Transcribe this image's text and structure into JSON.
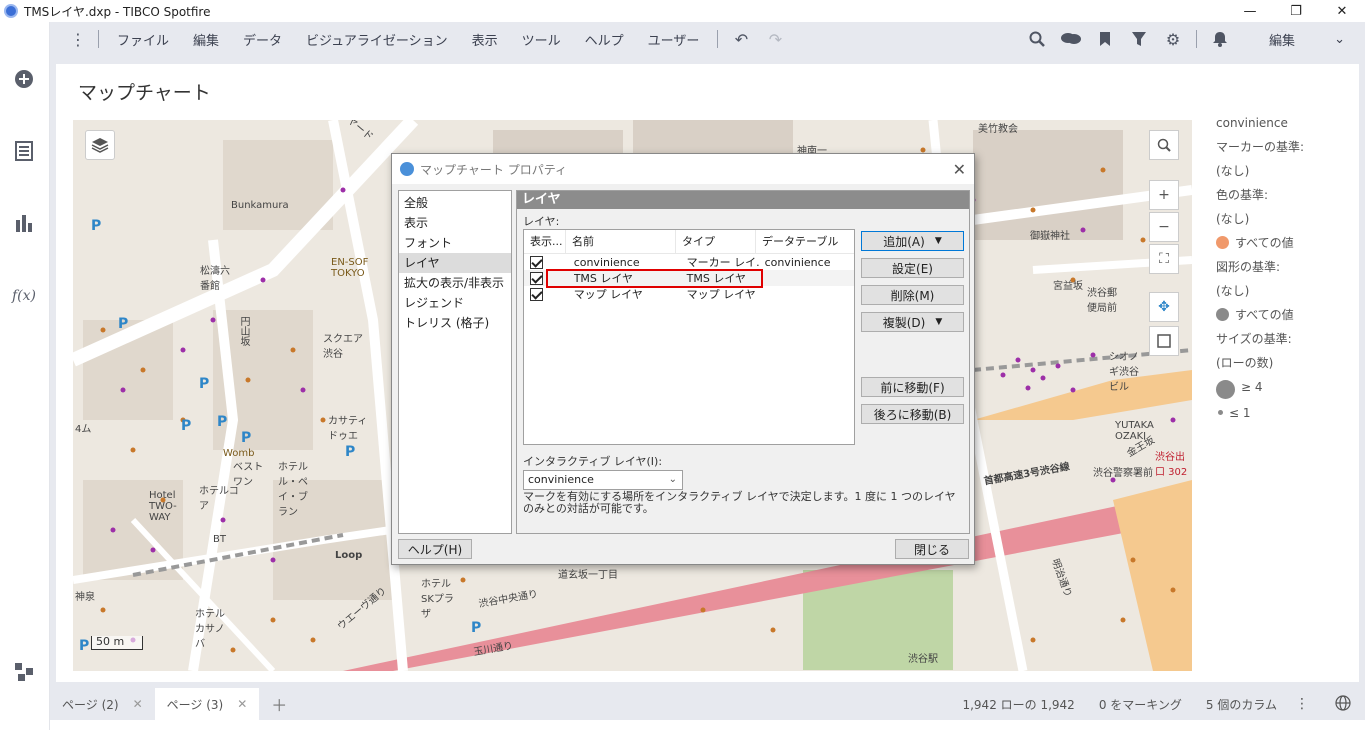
{
  "window": {
    "title": "TMSレイヤ.dxp - TIBCO Spotfire",
    "controls": [
      "—",
      "❐",
      "✕"
    ]
  },
  "rail": {
    "icons": [
      "add-icon",
      "data-table-icon",
      "bar-chart-icon",
      "function-icon",
      "flow-icon"
    ],
    "fx_label": "f(x)"
  },
  "menu": {
    "items": [
      "ファイル",
      "編集",
      "データ",
      "ビジュアライゼーション",
      "表示",
      "ツール",
      "ヘルプ",
      "ユーザー"
    ],
    "mode": "編集"
  },
  "viz": {
    "title": "マップチャート"
  },
  "map": {
    "scale": "50 m",
    "labels": [
      "Bunkamura",
      "松濤六番館",
      "EN-SOF TOKYO",
      "円山坂",
      "スクエア渋谷",
      "カサティドゥエ",
      "Womb",
      "ベストワン",
      "ホテルル・ペイ・ブラン",
      "ホテルコア",
      "Hotel TWO-WAY",
      "BT",
      "Loop",
      "ホテルSKプラザ",
      "ホテルカサノバ",
      "渋谷中央通り",
      "ウエーヴ通り",
      "玉川通り",
      "首都高速3号渋谷線",
      "道玄坂一丁目",
      "美竹教会",
      "御嶽神社",
      "宮益坂",
      "渋谷郵便局前",
      "シオノギ渋谷ビル",
      "YUTAKA OZAKI",
      "金王坂",
      "渋谷警察署前",
      "明治通り",
      "渋谷駅",
      "渋谷出口 302",
      "神南一",
      "神泉",
      "4ム",
      "ヤード"
    ]
  },
  "legend": {
    "title": "convinience",
    "marker_basis_label": "マーカーの基準:",
    "marker_basis_value": "(なし)",
    "color_basis_label": "色の基準:",
    "color_basis_value": "(なし)",
    "color_all": "すべての値",
    "shape_basis_label": "図形の基準:",
    "shape_basis_value": "(なし)",
    "shape_all": "すべての値",
    "size_basis_label": "サイズの基準:",
    "size_basis_value": "(ローの数)",
    "size_large": "≥ 4",
    "size_small": "≤ 1",
    "color_swatch": "#f0996b",
    "shape_swatch": "#8a8a8a"
  },
  "dialog": {
    "title": "マップチャート プロパティ",
    "nav": [
      "全般",
      "表示",
      "フォント",
      "レイヤ",
      "拡大の表示/非表示",
      "レジェンド",
      "トレリス (格子)"
    ],
    "selected_nav": "レイヤ",
    "header": "レイヤ",
    "layers_label": "レイヤ:",
    "columns": [
      "表示...",
      "名前",
      "タイプ",
      "データテーブル"
    ],
    "rows": [
      {
        "name": "convinience",
        "type": "マーカー レイ...",
        "table": "convinience"
      },
      {
        "name": "TMS レイヤ",
        "type": "TMS レイヤ",
        "table": ""
      },
      {
        "name": "マップ レイヤ",
        "type": "マップ レイヤ",
        "table": ""
      }
    ],
    "buttons": {
      "add": "追加(A)",
      "settings": "設定(E)",
      "delete": "削除(M)",
      "duplicate": "複製(D)",
      "move_up": "前に移動(F)",
      "move_down": "後ろに移動(B)",
      "help": "ヘルプ(H)",
      "close": "閉じる"
    },
    "interactive_label": "インタラクティブ レイヤ(I):",
    "interactive_value": "convinience",
    "description": "マークを有効にする場所をインタラクティブ レイヤで決定します。1 度に 1 つのレイヤのみとの対話が可能です。"
  },
  "status": {
    "tabs": [
      {
        "label": "ページ (2)"
      },
      {
        "label": "ページ (3)"
      }
    ],
    "add_tab": "＋",
    "rows": "1,942 ローの 1,942",
    "marking": "0 をマーキング",
    "columns": "5 個のカラム"
  }
}
